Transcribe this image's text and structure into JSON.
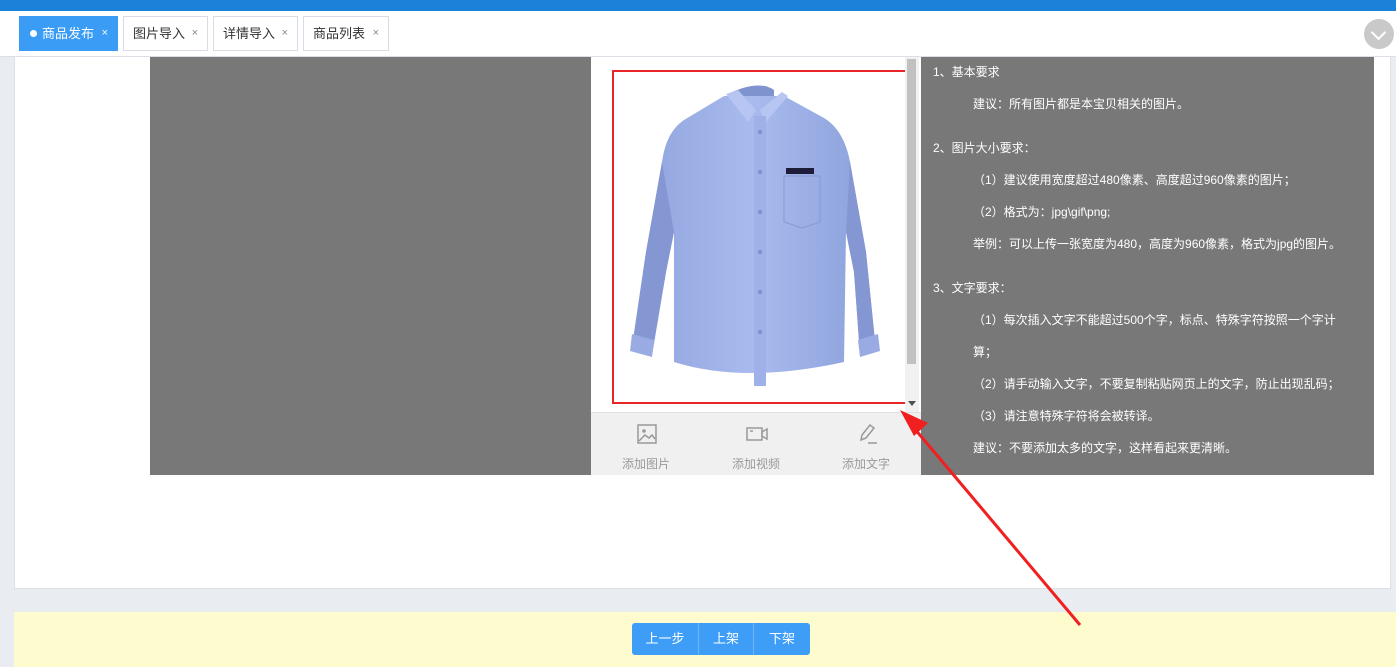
{
  "tabs": [
    {
      "label": "商品发布",
      "active": true
    },
    {
      "label": "图片导入",
      "active": false
    },
    {
      "label": "详情导入",
      "active": false
    },
    {
      "label": "商品列表",
      "active": false
    }
  ],
  "tab_close_glyph": "×",
  "toolbar": {
    "add_image": "添加图片",
    "add_video": "添加视频",
    "add_text": "添加文字"
  },
  "rules": {
    "s1_title": "1、基本要求",
    "s1_tip": "建议：所有图片都是本宝贝相关的图片。",
    "s2_title": "2、图片大小要求：",
    "s2_item1": "（1）建议使用宽度超过480像素、高度超过960像素的图片；",
    "s2_item2": "（2）格式为：jpg\\gif\\png;",
    "s2_example": "举例：可以上传一张宽度为480，高度为960像素，格式为jpg的图片。",
    "s3_title": "3、文字要求：",
    "s3_item1_a": "（1）每次插入文字不能超过500个字，标点、特殊字符按照一个字计",
    "s3_item1_b": "算；",
    "s3_item2": "（2）请手动输入文字，不要复制粘贴网页上的文字，防止出现乱码；",
    "s3_item3": "（3）请注意特殊字符将会被转译。",
    "s3_tip": "建议：不要添加太多的文字，这样看起来更清晰。"
  },
  "footer": {
    "prev": "上一步",
    "list": "上架",
    "delist": "下架"
  },
  "colors": {
    "accent": "#3b9cf5",
    "annotation_red": "#e8262a",
    "preview_bg": "#787878",
    "footer_bg": "#fefbcf"
  },
  "icons": [
    "image-icon",
    "video-icon",
    "pencil-icon",
    "chevron-down-icon",
    "close-icon"
  ]
}
